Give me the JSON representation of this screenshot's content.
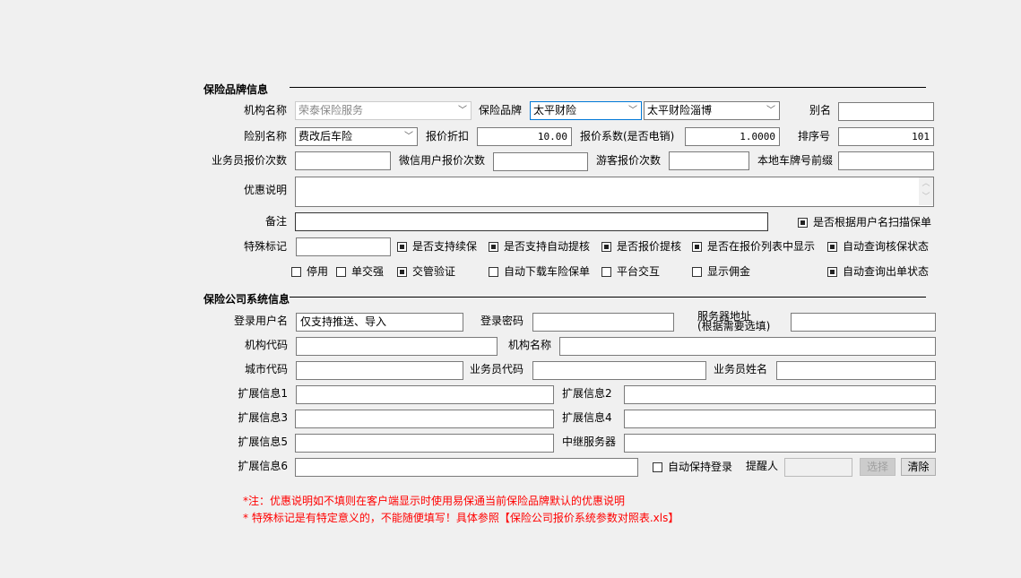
{
  "brand_section": {
    "title": "保险品牌信息",
    "org_name_label": "机构名称",
    "org_name_value": "荣泰保险服务",
    "brand_label": "保险品牌",
    "brand_value": "太平财险",
    "sub_brand_value": "太平财险淄博",
    "alias_label": "别名",
    "alias_value": "",
    "type_label": "险别名称",
    "type_value": "费改后车险",
    "discount_label": "报价折扣",
    "discount_value": "10.00",
    "coef_label": "报价系数(是否电销)",
    "coef_value": "1.0000",
    "order_label": "排序号",
    "order_value": "101",
    "agent_count_label": "业务员报价次数",
    "wechat_count_label": "微信用户报价次数",
    "guest_count_label": "游客报价次数",
    "plate_prefix_label": "本地车牌号前缀",
    "promo_label": "优惠说明",
    "remark_label": "备注",
    "special_label": "特殊标记",
    "checkboxes": [
      {
        "label": "是否根据用户名扫描保单",
        "checked": true
      },
      {
        "label": "是否支持续保",
        "checked": true
      },
      {
        "label": "是否支持自动提核",
        "checked": true
      },
      {
        "label": "是否报价提核",
        "checked": true
      },
      {
        "label": "是否在报价列表中显示",
        "checked": true
      },
      {
        "label": "自动查询核保状态",
        "checked": true
      },
      {
        "label": "停用",
        "checked": false
      },
      {
        "label": "单交强",
        "checked": false
      },
      {
        "label": "交管验证",
        "checked": true
      },
      {
        "label": "自动下载车险保单",
        "checked": false
      },
      {
        "label": "平台交互",
        "checked": false
      },
      {
        "label": "显示佣金",
        "checked": false
      },
      {
        "label": "自动查询出单状态",
        "checked": true
      }
    ]
  },
  "system_section": {
    "title": "保险公司系统信息",
    "login_user_label": "登录用户名",
    "login_user_value": "仅支持推送、导入",
    "login_pwd_label": "登录密码",
    "server_label_1": "服务器地址",
    "server_label_2": "(根据需要选填)",
    "org_code_label": "机构代码",
    "org_name_label": "机构名称",
    "city_code_label": "城市代码",
    "agent_code_label": "业务员代码",
    "agent_name_label": "业务员姓名",
    "ext1": "扩展信息1",
    "ext2": "扩展信息2",
    "ext3": "扩展信息3",
    "ext4": "扩展信息4",
    "ext5": "扩展信息5",
    "relay_label": "中继服务器",
    "ext6": "扩展信息6",
    "keep_login_label": "自动保持登录",
    "keep_login_checked": false,
    "reminder_label": "提醒人",
    "select_button": "选择",
    "clear_button": "清除"
  },
  "notes": [
    "*注：优惠说明如不填则在客户端显示时使用易保通当前保险品牌默认的优惠说明",
    "* 特殊标记是有特定意义的，不能随便填写！具体参照【保险公司报价系统参数对照表.xls】"
  ]
}
